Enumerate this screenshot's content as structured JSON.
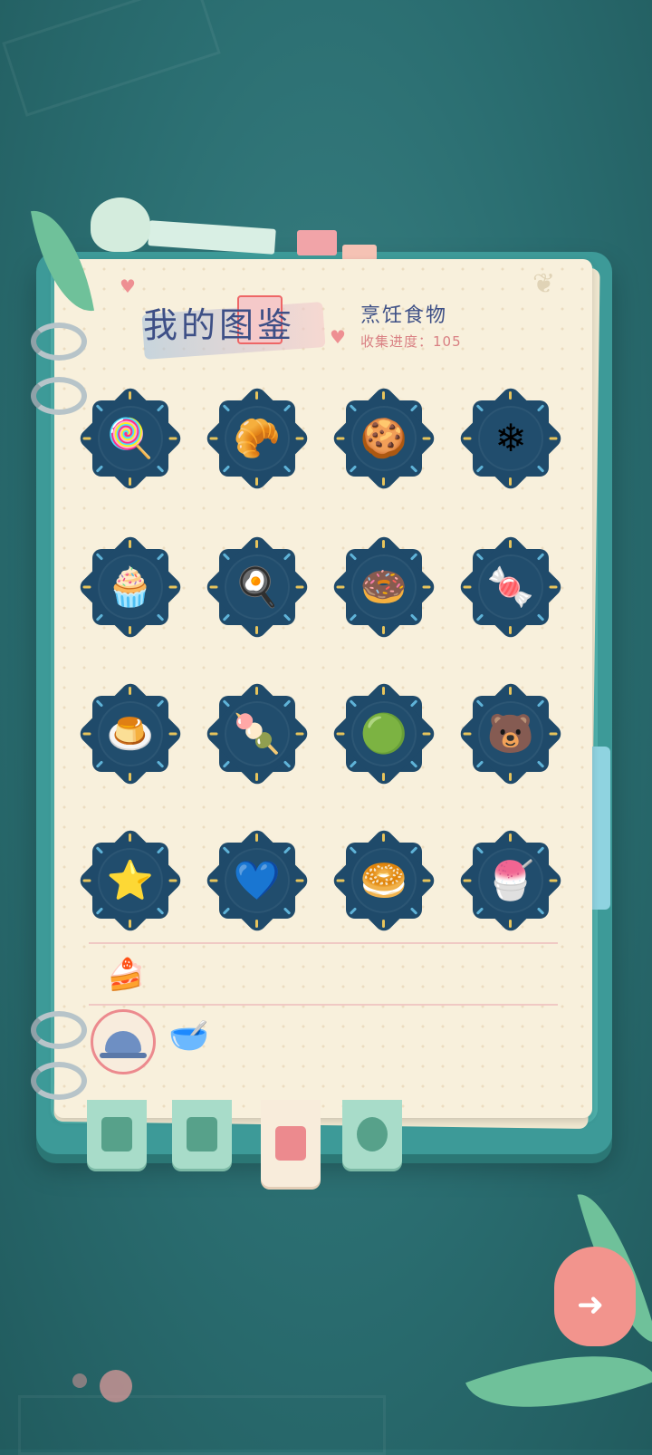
{
  "header": {
    "title": "我的图鉴",
    "category": "烹饪食物",
    "progress_label": "收集进度：",
    "progress_value": "105"
  },
  "colors": {
    "background": "#2a6d70",
    "book_cover": "#3d9a98",
    "paper": "#f8f0dc",
    "badge": "#1f4a6a",
    "title_text": "#3d4f86",
    "accent_pink": "#ec8a8e",
    "tab_green": "#a8dcc9"
  },
  "items": [
    {
      "name": "candy-flower",
      "icon": "🍭"
    },
    {
      "name": "croissant",
      "icon": "🥐"
    },
    {
      "name": "chocolate-cookies",
      "icon": "🍪"
    },
    {
      "name": "snowflake-cookie",
      "icon": "❄"
    },
    {
      "name": "cloud-cake",
      "icon": "🧁"
    },
    {
      "name": "egg-tart",
      "icon": "🍳"
    },
    {
      "name": "donut",
      "icon": "🍩"
    },
    {
      "name": "candy-cane",
      "icon": "🍬"
    },
    {
      "name": "blue-pudding",
      "icon": "🍮"
    },
    {
      "name": "pink-cotton-candy",
      "icon": "🍡"
    },
    {
      "name": "green-jelly",
      "icon": "🟢"
    },
    {
      "name": "bear-cake",
      "icon": "🐻"
    },
    {
      "name": "star-cookie",
      "icon": "⭐"
    },
    {
      "name": "heart-roll-cake",
      "icon": "💙"
    },
    {
      "name": "cat-bun",
      "icon": "🥯"
    },
    {
      "name": "shaved-ice",
      "icon": "🍧"
    }
  ],
  "categories": [
    {
      "name": "dessert",
      "icon": "🍰"
    },
    {
      "name": "dish",
      "icon": "🍽"
    },
    {
      "name": "bowl",
      "icon": "🥣"
    }
  ],
  "tabs": [
    {
      "name": "notes",
      "icon": "notes-icon"
    },
    {
      "name": "album",
      "icon": "album-icon"
    },
    {
      "name": "collection",
      "icon": "book-icon"
    },
    {
      "name": "flower",
      "icon": "flower-icon"
    }
  ],
  "back_button": {
    "icon": "back-arrow-icon"
  }
}
